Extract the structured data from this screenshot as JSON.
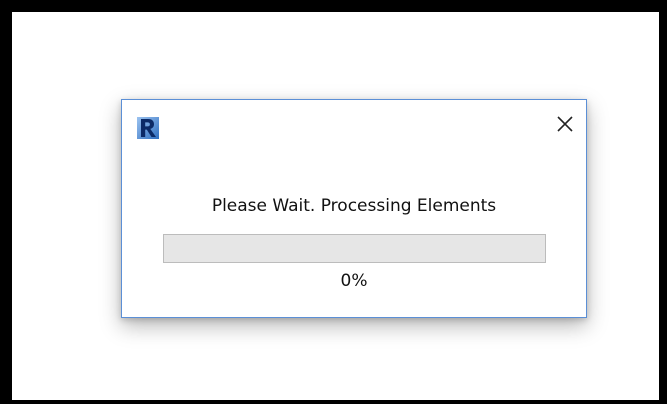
{
  "dialog": {
    "app_icon": "revit-logo-icon",
    "close_icon": "close-icon",
    "message": "Please Wait. Processing Elements",
    "progress_value": 0,
    "progress_label": "0%"
  },
  "colors": {
    "dialog_border": "#5b8fd6",
    "progress_track": "#e6e6e6",
    "progress_fill": "#06b025",
    "screen_border": "#000000"
  }
}
